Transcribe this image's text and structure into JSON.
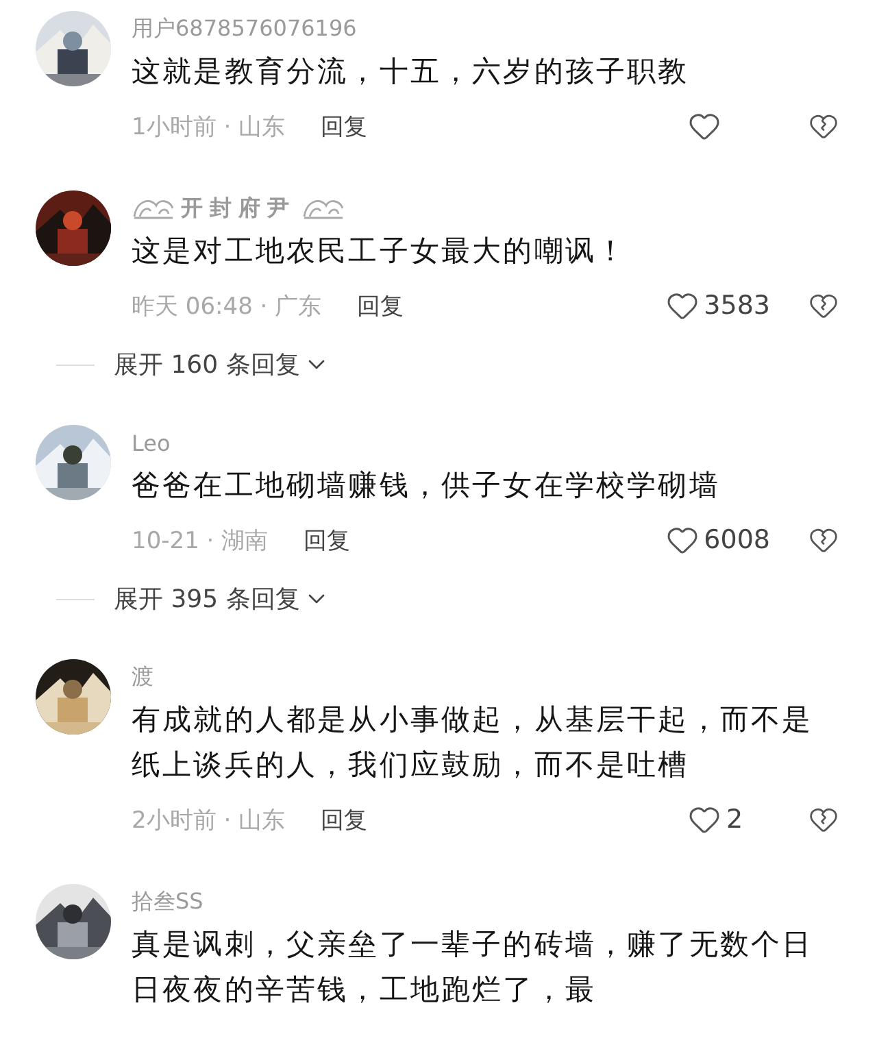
{
  "comments": [
    {
      "name": "用户6878576076196",
      "name_ornaments": false,
      "body": "这就是教育分流，十五，六岁的孩子职教",
      "time_location": "1小时前 · 山东",
      "reply_label": "回复"
    },
    {
      "name": "开封府尹",
      "name_ornaments": true,
      "body": "这是对工地农民工子女最大的嘲讽！",
      "time_location": "昨天 06:48 · 广东",
      "reply_label": "回复",
      "likes": "3583",
      "expand_replies": "展开 160 条回复"
    },
    {
      "name": "Leo",
      "name_ornaments": false,
      "body": "爸爸在工地砌墙赚钱，供子女在学校学砌墙",
      "time_location": "10-21 · 湖南",
      "reply_label": "回复",
      "likes": "6008",
      "expand_replies": "展开 395 条回复"
    },
    {
      "name": "渡",
      "name_ornaments": false,
      "body": "有成就的人都是从小事做起，从基层干起，而不是纸上谈兵的人，我们应鼓励，而不是吐槽",
      "time_location": "2小时前 · 山东",
      "reply_label": "回复",
      "likes": "2"
    },
    {
      "name": "拾叁SS",
      "name_ornaments": false,
      "body": "真是讽刺，父亲垒了一辈子的砖墙，赚了无数个日日夜夜的辛苦钱，工地跑烂了，最"
    }
  ]
}
